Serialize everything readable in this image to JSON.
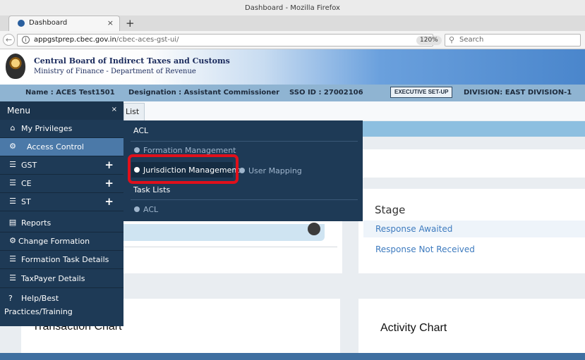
{
  "browser": {
    "window_title": "Dashboard - Mozilla Firefox",
    "tab_label": "Dashboard",
    "tab_close": "×",
    "new_tab": "+",
    "url_domain": "appgstprep.cbec.gov.in",
    "url_path": "/cbec-aces-gst-ui/",
    "zoom": "120%",
    "reload": "C",
    "search_placeholder": "Search"
  },
  "site": {
    "org_name": "Central Board of Indirect Taxes and Customs",
    "org_sub": "Ministry of Finance - Department of Revenue"
  },
  "userbar": {
    "name": "Name : ACES Test1501",
    "designation": "Designation : Assistant Commissioner",
    "sso": "SSO ID : 27002106",
    "exec_button": "EXECUTIVE SET-UP",
    "division": "DIVISION:  EAST DIVISION-1"
  },
  "sidebar": {
    "title": "Menu",
    "close": "×",
    "items": [
      {
        "label": "My Privileges",
        "icon": "home-icon"
      },
      {
        "label": "Access Control",
        "icon": "dashboard-icon"
      },
      {
        "label": "GST",
        "icon": "list-icon"
      },
      {
        "label": "CE",
        "icon": "list-icon"
      },
      {
        "label": "ST",
        "icon": "list-icon"
      },
      {
        "label": "Reports",
        "icon": "file-icon"
      },
      {
        "label": "Change Formation",
        "icon": "gear-icon"
      },
      {
        "label": "Formation Task Details",
        "icon": "tasks-icon"
      },
      {
        "label": "TaxPayer Details",
        "icon": "tasks-icon"
      },
      {
        "label_line1": "Help/Best",
        "label_line2": "Practices/Training",
        "icon": "question-icon"
      }
    ]
  },
  "dropdown": {
    "section1": "ACL",
    "formation_management": "Formation Management",
    "jurisdiction_management": "Jurisdiction Management",
    "user_mapping": "User Mapping",
    "section2": "Task Lists",
    "acl_link": "ACL"
  },
  "page": {
    "list_tab": "List",
    "stage_title": "Stage",
    "stage_rows": [
      "Response Awaited",
      "Response Not Received"
    ],
    "transaction_chart": "Transaction Chart",
    "activity_chart": "Activity Chart"
  },
  "colors": {
    "sidebar_bg": "#1e3a56",
    "active_item": "#4b79a8",
    "highlight": "#e0101b",
    "link": "#3e7bbf"
  }
}
